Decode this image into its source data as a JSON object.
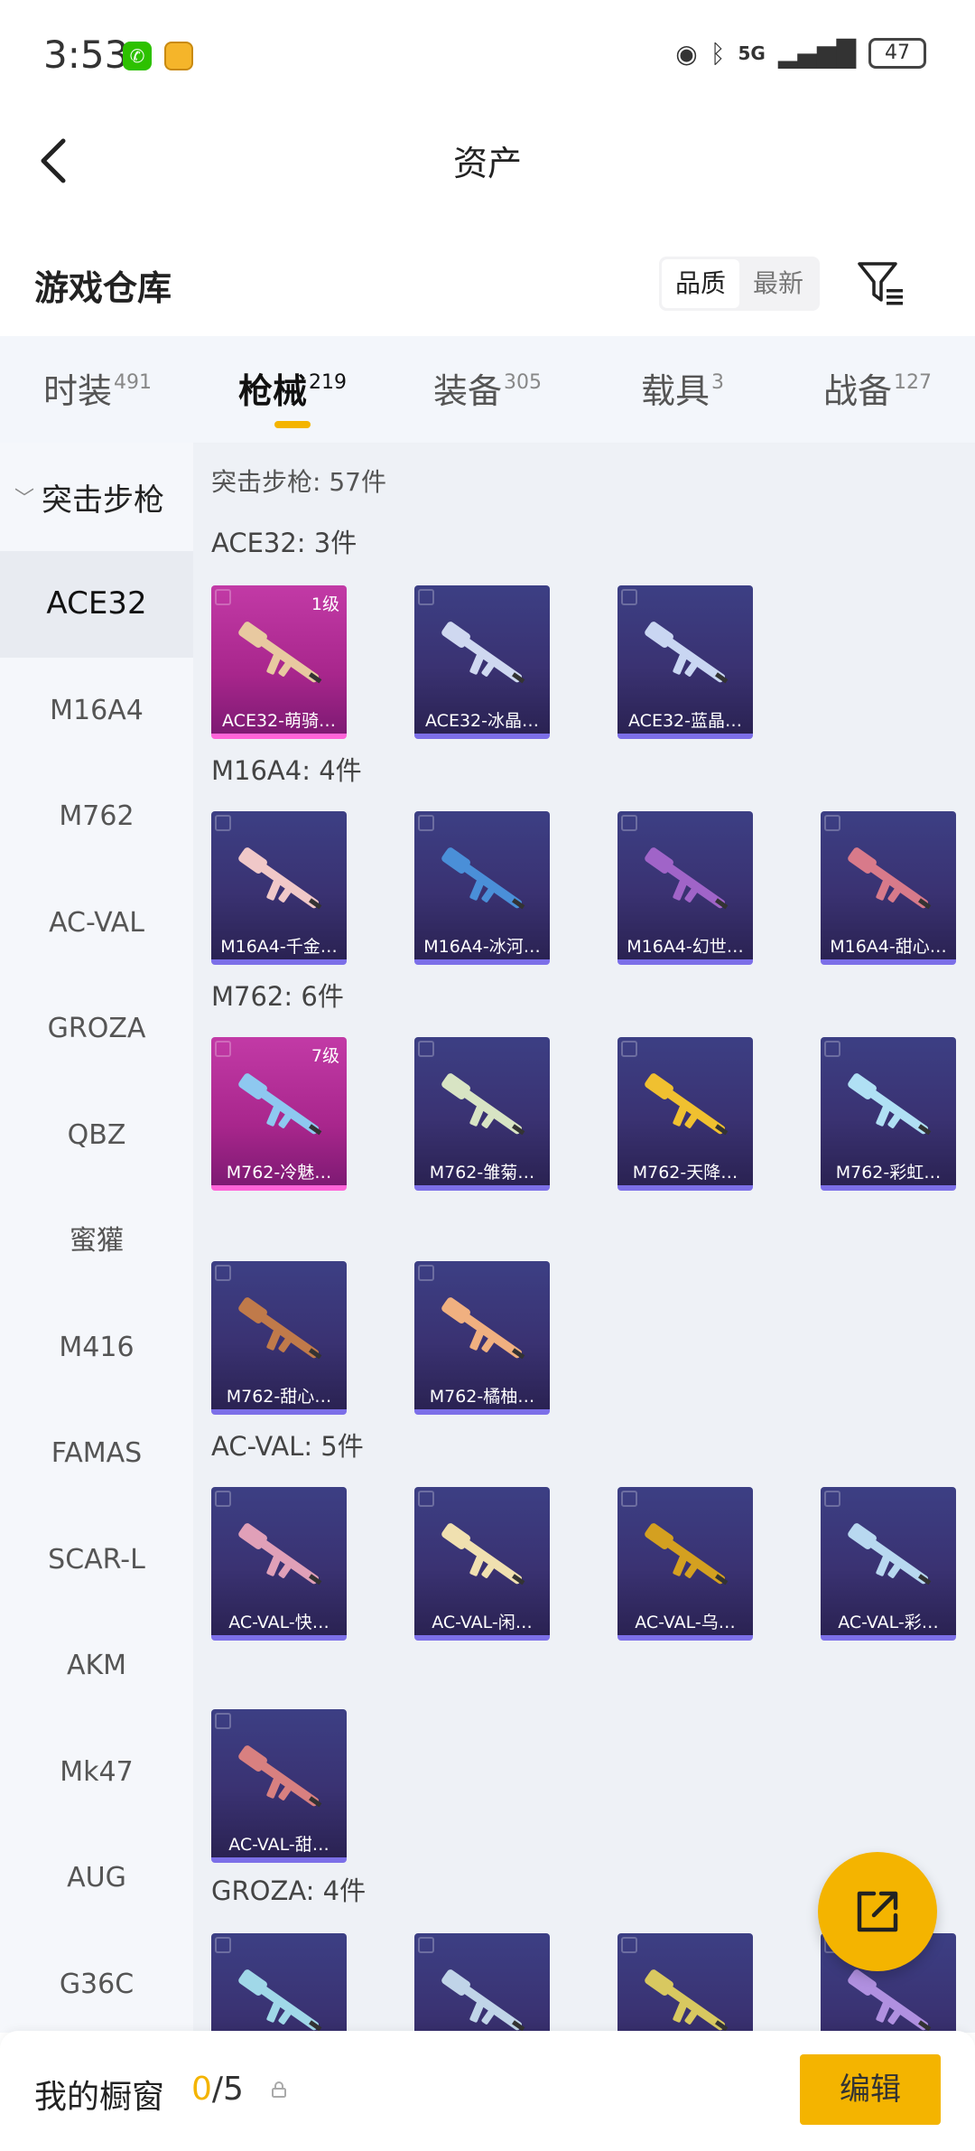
{
  "status": {
    "time": "3:53",
    "battery": "47",
    "network": "5G"
  },
  "header": {
    "title": "资产"
  },
  "section": {
    "title": "游戏仓库",
    "sort_options": [
      "品质",
      "最新"
    ]
  },
  "tabs": [
    {
      "label": "时装",
      "count": "491"
    },
    {
      "label": "枪械",
      "count": "219"
    },
    {
      "label": "装备",
      "count": "305"
    },
    {
      "label": "载具",
      "count": "3"
    },
    {
      "label": "战备",
      "count": "127"
    }
  ],
  "sidebar": {
    "category": "突击步枪",
    "items": [
      "ACE32",
      "M16A4",
      "M762",
      "AC-VAL",
      "GROZA",
      "QBZ",
      "蜜獾",
      "M416",
      "FAMAS",
      "SCAR-L",
      "AKM",
      "Mk47",
      "AUG",
      "G36C"
    ]
  },
  "main": {
    "summary": "突击步枪: 57件",
    "groups": [
      {
        "title": "ACE32: 3件",
        "items": [
          {
            "name": "ACE32-萌骑…",
            "level": "1级",
            "style": "pink",
            "gun": "#e8c9a0"
          },
          {
            "name": "ACE32-冰晶…",
            "style": "purple",
            "gun": "#cfd8f0"
          },
          {
            "name": "ACE32-蓝晶…",
            "style": "purple",
            "gun": "#c9d6f2"
          }
        ]
      },
      {
        "title": "M16A4: 4件",
        "items": [
          {
            "name": "M16A4-千金…",
            "style": "purple",
            "gun": "#f0c8c8"
          },
          {
            "name": "M16A4-冰河…",
            "style": "purple",
            "gun": "#4a8fd8"
          },
          {
            "name": "M16A4-幻世…",
            "style": "purple",
            "gun": "#a064c8"
          },
          {
            "name": "M16A4-甜心…",
            "style": "purple",
            "gun": "#d87a8a"
          }
        ]
      },
      {
        "title": "M762: 6件",
        "items": [
          {
            "name": "M762-冷魅…",
            "level": "7级",
            "style": "pink",
            "gun": "#8ec8f0"
          },
          {
            "name": "M762-雏菊…",
            "style": "purple",
            "gun": "#d8e4c4"
          },
          {
            "name": "M762-天降…",
            "style": "purple",
            "gun": "#f0c030"
          },
          {
            "name": "M762-彩虹…",
            "style": "purple",
            "gun": "#b0e0f4"
          },
          {
            "name": "M762-甜心…",
            "style": "purple",
            "gun": "#c07a4a"
          },
          {
            "name": "M762-橘柚…",
            "style": "purple",
            "gun": "#f0b080"
          }
        ]
      },
      {
        "title": "AC-VAL: 5件",
        "items": [
          {
            "name": "AC-VAL-快…",
            "style": "purple",
            "gun": "#e0a0b8"
          },
          {
            "name": "AC-VAL-闲…",
            "style": "purple",
            "gun": "#f0e0b0"
          },
          {
            "name": "AC-VAL-乌…",
            "style": "purple",
            "gun": "#d4a020"
          },
          {
            "name": "AC-VAL-彩…",
            "style": "purple",
            "gun": "#b8d8f0"
          },
          {
            "name": "AC-VAL-甜…",
            "style": "purple",
            "gun": "#d88080"
          }
        ]
      },
      {
        "title": "GROZA: 4件",
        "items": [
          {
            "name": "",
            "style": "purple",
            "gun": "#a0d8e8"
          },
          {
            "name": "",
            "style": "purple",
            "gun": "#c0d4e8"
          },
          {
            "name": "",
            "style": "purple",
            "gun": "#d8c860"
          },
          {
            "name": "",
            "style": "purple",
            "gun": "#b090e0"
          }
        ]
      }
    ]
  },
  "showcase": {
    "label": "我的橱窗",
    "used": "0",
    "total": "/5",
    "edit_label": "编辑"
  }
}
